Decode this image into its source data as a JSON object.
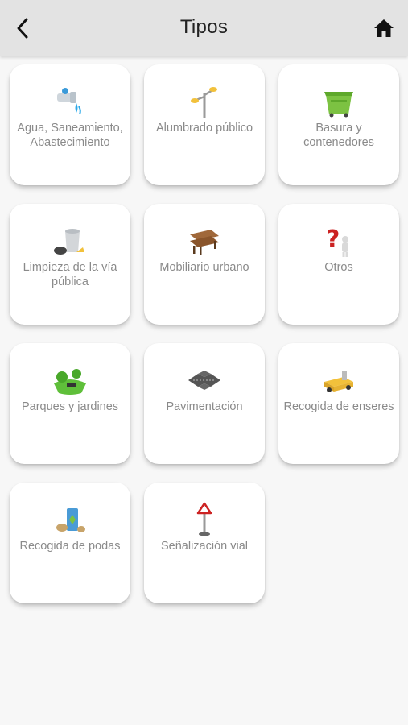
{
  "header": {
    "title": "Tipos",
    "back_icon": "chevron-left-icon",
    "home_icon": "home-icon"
  },
  "colors": {
    "header_bg": "#e3e3e3",
    "background": "#f7f7f7",
    "card_bg": "#ffffff",
    "label_text": "#8a8a8a"
  },
  "categories": [
    {
      "label": "Agua, Saneamiento, Abastecimiento",
      "icon": "water-faucet-icon"
    },
    {
      "label": "Alumbrado público",
      "icon": "street-lamp-icon"
    },
    {
      "label": "Basura y contenedores",
      "icon": "dumpster-icon"
    },
    {
      "label": "Limpieza de la vía pública",
      "icon": "trash-can-icon"
    },
    {
      "label": "Mobiliario urbano",
      "icon": "bench-icon"
    },
    {
      "label": "Otros",
      "icon": "question-figure-icon"
    },
    {
      "label": "Parques y jardines",
      "icon": "park-icon"
    },
    {
      "label": "Pavimentación",
      "icon": "road-intersection-icon"
    },
    {
      "label": "Recogida de enseres",
      "icon": "tow-truck-icon"
    },
    {
      "label": "Recogida de podas",
      "icon": "pruning-waste-icon"
    },
    {
      "label": "Señalización vial",
      "icon": "road-sign-icon"
    }
  ]
}
